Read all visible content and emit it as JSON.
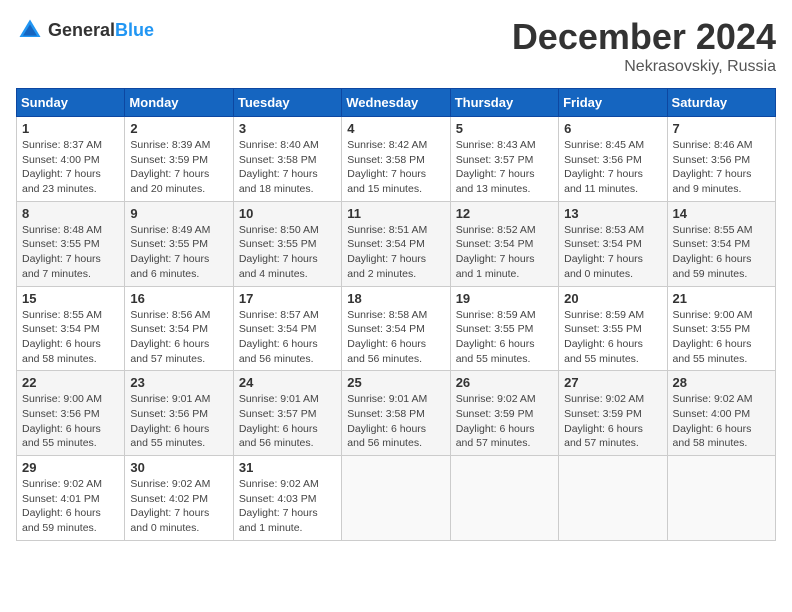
{
  "header": {
    "logo_general": "General",
    "logo_blue": "Blue",
    "title": "December 2024",
    "location": "Nekrasovskiy, Russia"
  },
  "calendar": {
    "days_of_week": [
      "Sunday",
      "Monday",
      "Tuesday",
      "Wednesday",
      "Thursday",
      "Friday",
      "Saturday"
    ],
    "weeks": [
      [
        {
          "day": "",
          "detail": ""
        },
        {
          "day": "2",
          "detail": "Sunrise: 8:39 AM\nSunset: 3:59 PM\nDaylight: 7 hours\nand 20 minutes."
        },
        {
          "day": "3",
          "detail": "Sunrise: 8:40 AM\nSunset: 3:58 PM\nDaylight: 7 hours\nand 18 minutes."
        },
        {
          "day": "4",
          "detail": "Sunrise: 8:42 AM\nSunset: 3:58 PM\nDaylight: 7 hours\nand 15 minutes."
        },
        {
          "day": "5",
          "detail": "Sunrise: 8:43 AM\nSunset: 3:57 PM\nDaylight: 7 hours\nand 13 minutes."
        },
        {
          "day": "6",
          "detail": "Sunrise: 8:45 AM\nSunset: 3:56 PM\nDaylight: 7 hours\nand 11 minutes."
        },
        {
          "day": "7",
          "detail": "Sunrise: 8:46 AM\nSunset: 3:56 PM\nDaylight: 7 hours\nand 9 minutes."
        }
      ],
      [
        {
          "day": "8",
          "detail": "Sunrise: 8:48 AM\nSunset: 3:55 PM\nDaylight: 7 hours\nand 7 minutes."
        },
        {
          "day": "9",
          "detail": "Sunrise: 8:49 AM\nSunset: 3:55 PM\nDaylight: 7 hours\nand 6 minutes."
        },
        {
          "day": "10",
          "detail": "Sunrise: 8:50 AM\nSunset: 3:55 PM\nDaylight: 7 hours\nand 4 minutes."
        },
        {
          "day": "11",
          "detail": "Sunrise: 8:51 AM\nSunset: 3:54 PM\nDaylight: 7 hours\nand 2 minutes."
        },
        {
          "day": "12",
          "detail": "Sunrise: 8:52 AM\nSunset: 3:54 PM\nDaylight: 7 hours\nand 1 minute."
        },
        {
          "day": "13",
          "detail": "Sunrise: 8:53 AM\nSunset: 3:54 PM\nDaylight: 7 hours\nand 0 minutes."
        },
        {
          "day": "14",
          "detail": "Sunrise: 8:55 AM\nSunset: 3:54 PM\nDaylight: 6 hours\nand 59 minutes."
        }
      ],
      [
        {
          "day": "15",
          "detail": "Sunrise: 8:55 AM\nSunset: 3:54 PM\nDaylight: 6 hours\nand 58 minutes."
        },
        {
          "day": "16",
          "detail": "Sunrise: 8:56 AM\nSunset: 3:54 PM\nDaylight: 6 hours\nand 57 minutes."
        },
        {
          "day": "17",
          "detail": "Sunrise: 8:57 AM\nSunset: 3:54 PM\nDaylight: 6 hours\nand 56 minutes."
        },
        {
          "day": "18",
          "detail": "Sunrise: 8:58 AM\nSunset: 3:54 PM\nDaylight: 6 hours\nand 56 minutes."
        },
        {
          "day": "19",
          "detail": "Sunrise: 8:59 AM\nSunset: 3:55 PM\nDaylight: 6 hours\nand 55 minutes."
        },
        {
          "day": "20",
          "detail": "Sunrise: 8:59 AM\nSunset: 3:55 PM\nDaylight: 6 hours\nand 55 minutes."
        },
        {
          "day": "21",
          "detail": "Sunrise: 9:00 AM\nSunset: 3:55 PM\nDaylight: 6 hours\nand 55 minutes."
        }
      ],
      [
        {
          "day": "22",
          "detail": "Sunrise: 9:00 AM\nSunset: 3:56 PM\nDaylight: 6 hours\nand 55 minutes."
        },
        {
          "day": "23",
          "detail": "Sunrise: 9:01 AM\nSunset: 3:56 PM\nDaylight: 6 hours\nand 55 minutes."
        },
        {
          "day": "24",
          "detail": "Sunrise: 9:01 AM\nSunset: 3:57 PM\nDaylight: 6 hours\nand 56 minutes."
        },
        {
          "day": "25",
          "detail": "Sunrise: 9:01 AM\nSunset: 3:58 PM\nDaylight: 6 hours\nand 56 minutes."
        },
        {
          "day": "26",
          "detail": "Sunrise: 9:02 AM\nSunset: 3:59 PM\nDaylight: 6 hours\nand 57 minutes."
        },
        {
          "day": "27",
          "detail": "Sunrise: 9:02 AM\nSunset: 3:59 PM\nDaylight: 6 hours\nand 57 minutes."
        },
        {
          "day": "28",
          "detail": "Sunrise: 9:02 AM\nSunset: 4:00 PM\nDaylight: 6 hours\nand 58 minutes."
        }
      ],
      [
        {
          "day": "29",
          "detail": "Sunrise: 9:02 AM\nSunset: 4:01 PM\nDaylight: 6 hours\nand 59 minutes."
        },
        {
          "day": "30",
          "detail": "Sunrise: 9:02 AM\nSunset: 4:02 PM\nDaylight: 7 hours\nand 0 minutes."
        },
        {
          "day": "31",
          "detail": "Sunrise: 9:02 AM\nSunset: 4:03 PM\nDaylight: 7 hours\nand 1 minute."
        },
        {
          "day": "",
          "detail": ""
        },
        {
          "day": "",
          "detail": ""
        },
        {
          "day": "",
          "detail": ""
        },
        {
          "day": "",
          "detail": ""
        }
      ]
    ],
    "week1_sunday": {
      "day": "1",
      "detail": "Sunrise: 8:37 AM\nSunset: 4:00 PM\nDaylight: 7 hours\nand 23 minutes."
    }
  }
}
